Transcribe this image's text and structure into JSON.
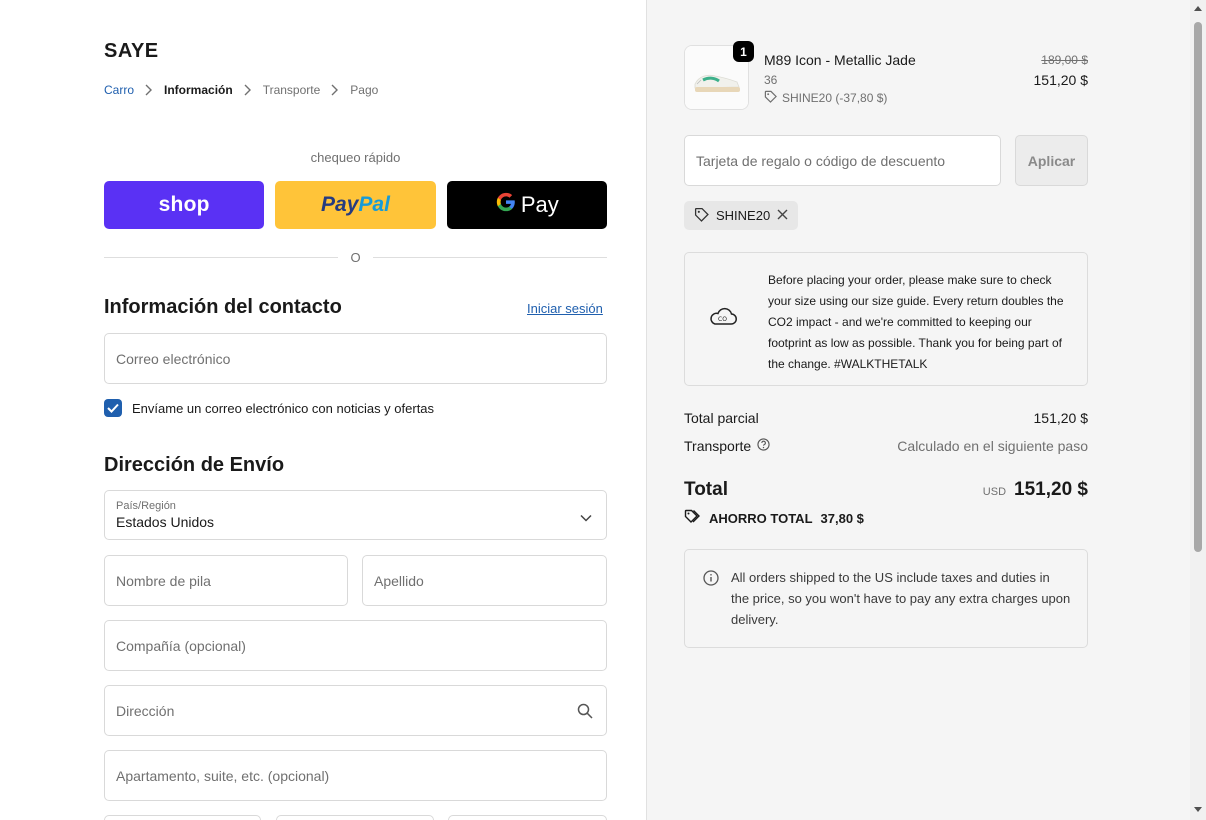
{
  "store": {
    "name": "SAYE"
  },
  "breadcrumbs": [
    "Carro",
    "Información",
    "Transporte",
    "Pago"
  ],
  "express": {
    "heading": "chequeo rápido",
    "shop_label": "shop",
    "paypal_label_a": "Pay",
    "paypal_label_b": "Pal",
    "gpay_label": "Pay",
    "divider_label": "O"
  },
  "contact": {
    "title": "Información del contacto",
    "signin": "Iniciar sesión",
    "email_placeholder": "Correo electrónico",
    "newsletter_label": "Envíame un correo electrónico con noticias y ofertas",
    "newsletter_checked": true
  },
  "shipping": {
    "title": "Dirección de Envío",
    "country_label": "País/Región",
    "country_value": "Estados Unidos",
    "first_name": "Nombre de pila",
    "last_name": "Apellido",
    "company": "Compañía (opcional)",
    "address": "Dirección",
    "apartment": "Apartamento, suite, etc. (opcional)"
  },
  "product": {
    "quantity": "1",
    "name": "M89 Icon - Metallic Jade",
    "variant": "36",
    "discount": "SHINE20 (-37,80 $)",
    "original_price": "189,00 $",
    "price": "151,20 $"
  },
  "discount": {
    "placeholder": "Tarjeta de regalo o código de descuento",
    "apply_label": "Aplicar",
    "applied_code": "SHINE20"
  },
  "notice": {
    "text": "Before placing your order, please make sure to check your size using our size guide. Every return doubles the CO2 impact - and we're committed to keeping our footprint as low as possible. Thank you for being part of the change. #WALKTHETALK"
  },
  "summary": {
    "subtotal_label": "Total parcial",
    "subtotal_value": "151,20 $",
    "shipping_label": "Transporte",
    "shipping_value": "Calculado en el siguiente paso",
    "total_label": "Total",
    "currency": "USD",
    "total_value": "151,20 $",
    "savings_label": "AHORRO TOTAL",
    "savings_value": "37,80 $"
  },
  "info": {
    "text": "All orders shipped to the US include taxes and duties in the price, so you won't have to pay any extra charges upon delivery."
  },
  "colors": {
    "shop": "#5a31f4",
    "paypal": "#ffc439",
    "gpay": "#000000",
    "link": "#1f5fae"
  }
}
